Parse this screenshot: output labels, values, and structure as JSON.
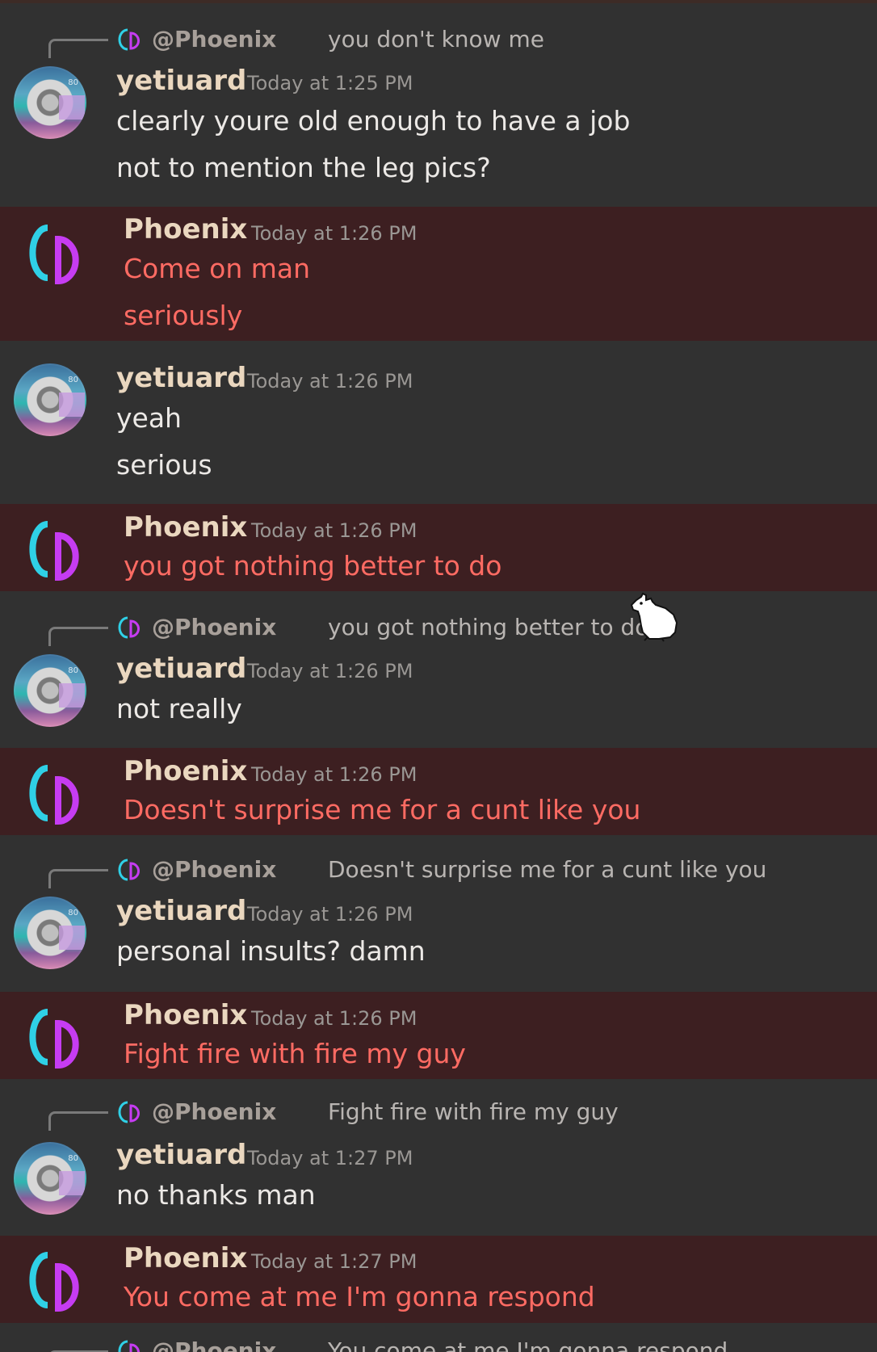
{
  "messages": [
    {
      "author": "yetiuard",
      "time": "Today at 1:25 PM",
      "reply": {
        "mention": "@Phoenix",
        "text": "you don't know me"
      },
      "lines": [
        "clearly youre old enough to have a job",
        "not to mention the leg pics?"
      ]
    },
    {
      "author": "Phoenix",
      "time": "Today at 1:26 PM",
      "lines": [
        "Come on man",
        "seriously"
      ]
    },
    {
      "author": "yetiuard",
      "time": "Today at 1:26 PM",
      "lines": [
        "yeah",
        "serious"
      ]
    },
    {
      "author": "Phoenix",
      "time": "Today at 1:26 PM",
      "lines": [
        "you got nothing better to do"
      ]
    },
    {
      "author": "yetiuard",
      "time": "Today at 1:26 PM",
      "reply": {
        "mention": "@Phoenix",
        "text": "you got nothing better to do"
      },
      "lines": [
        "not really"
      ]
    },
    {
      "author": "Phoenix",
      "time": "Today at 1:26 PM",
      "lines": [
        "Doesn't surprise me for a cunt like you"
      ]
    },
    {
      "author": "yetiuard",
      "time": "Today at 1:26 PM",
      "reply": {
        "mention": "@Phoenix",
        "text": "Doesn't surprise me for a cunt like you"
      },
      "lines": [
        "personal insults? damn"
      ]
    },
    {
      "author": "Phoenix",
      "time": "Today at 1:26 PM",
      "lines": [
        "Fight fire with fire my guy"
      ]
    },
    {
      "author": "yetiuard",
      "time": "Today at 1:27 PM",
      "reply": {
        "mention": "@Phoenix",
        "text": "Fight fire with fire my guy"
      },
      "lines": [
        "no thanks man"
      ]
    },
    {
      "author": "Phoenix",
      "time": "Today at 1:27 PM",
      "lines": [
        "You come at me I'm gonna respond"
      ]
    },
    {
      "reply": {
        "mention": "@Phoenix",
        "text": "You come at me I'm gonna respond"
      }
    }
  ],
  "avatar_badge": "80",
  "colors": {
    "background": "#313131",
    "phoenix_row": "#3d1f21",
    "username": "#ead7bf",
    "timestamp": "#9a9794",
    "message_text": "#ece9e6",
    "phoenix_text": "#ff6b63"
  },
  "icons": {
    "phoenix_avatar": "phoenix-logo-icon",
    "reply_icon": "phoenix-logo-icon",
    "cursor": "bunny-cursor-icon"
  }
}
